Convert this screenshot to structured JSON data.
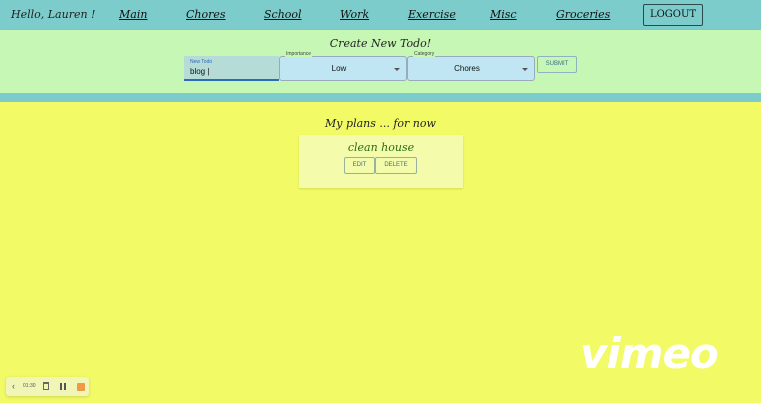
{
  "header": {
    "greeting": "Hello, Lauren !",
    "nav": [
      "Main",
      "Chores",
      "School",
      "Work",
      "Exercise",
      "Misc",
      "Groceries"
    ],
    "logout_label": "LOGOUT"
  },
  "create_form": {
    "title": "Create New Todo!",
    "todo_label": "New Todo",
    "todo_value": "blog |",
    "importance_label": "Importance",
    "importance_value": "Low",
    "category_label": "Category",
    "category_value": "Chores",
    "submit_label": "SUBMIT"
  },
  "plans": {
    "title": "My plans ... for now",
    "items": [
      {
        "text": "clean house",
        "edit_label": "EDIT",
        "delete_label": "DELETE"
      }
    ]
  },
  "player": {
    "time": "01:30",
    "icons": [
      "chevron-left-icon",
      "trash-icon",
      "pause-icon",
      "stop-icon"
    ],
    "brand": "vimeo"
  },
  "colors": {
    "nav_bg": "#7ccccc",
    "form_bg": "#c6f7b4",
    "page_bg": "#f2fa65",
    "card_bg": "#f4fcab",
    "todo_text": "#2a6c10",
    "stop_accent": "#f19a44"
  }
}
